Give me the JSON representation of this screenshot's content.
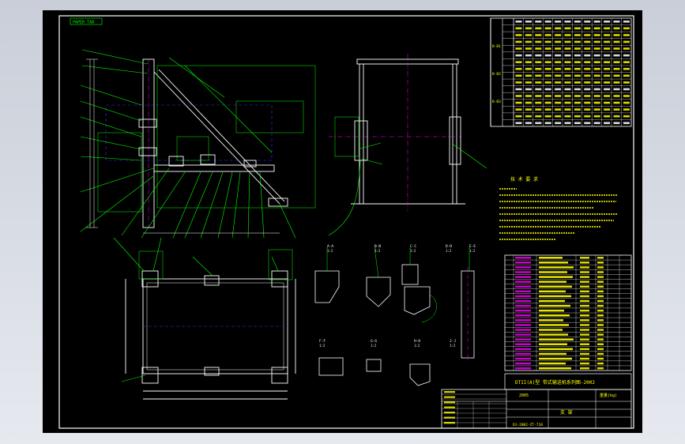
{
  "header_stamp": "PAPER TAB",
  "section_labels": [
    "A-A",
    "B-B",
    "C-C",
    "D-D",
    "E-E",
    "F-F",
    "G-G",
    "H-H",
    "J-J"
  ],
  "scale_labels": [
    "1:2",
    "1:2",
    "1:2",
    "1:2",
    "1:2",
    "1:2",
    "1:2",
    "1:2",
    "1:2"
  ],
  "table_row_groups": [
    "B-B1",
    "B-B2",
    "B-B3"
  ],
  "notes_title": "技 术 要 求",
  "title_block": {
    "drawing_title": "DTII(A)型 带式输送机系列图-2002",
    "project": "2005",
    "weight": "重量(kg)",
    "sheet_label": "支 架",
    "code": "DJ-2002-ZT-710"
  },
  "colors": {
    "drawing_bg": "#000000",
    "frame": "#ffffff",
    "part": "#ffffff",
    "leader": "#00ff00",
    "centerline": "#ff00ff",
    "hidden": "#0000ff",
    "accent": "#ffff00"
  }
}
